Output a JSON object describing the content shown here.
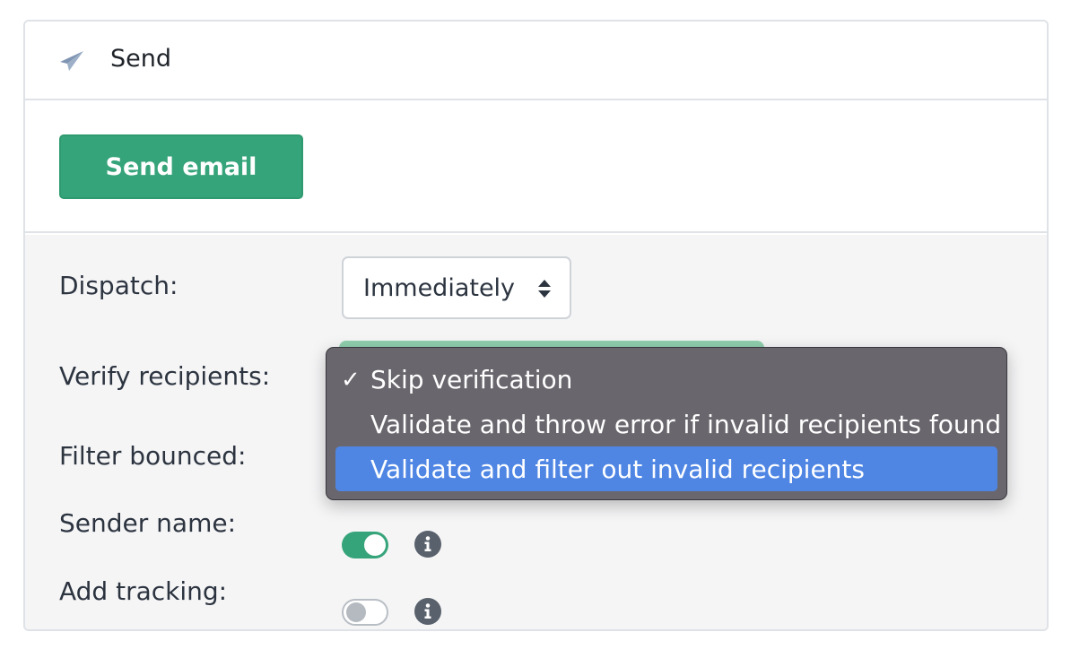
{
  "header": {
    "icon": "paper-plane-icon",
    "title": "Send"
  },
  "actions": {
    "send_email_label": "Send email"
  },
  "settings": {
    "dispatch": {
      "label": "Dispatch:",
      "value": "Immediately",
      "icon": "select-arrows-icon"
    },
    "verify_recipients": {
      "label": "Verify recipients:",
      "options": [
        {
          "label": "Skip verification",
          "checked": true
        },
        {
          "label": "Validate and throw error if invalid recipients found",
          "checked": false
        },
        {
          "label": "Validate and filter out invalid recipients",
          "checked": false,
          "highlighted": true
        }
      ],
      "check_mark": "✓"
    },
    "filter_bounced": {
      "label": "Filter bounced:"
    },
    "sender_name": {
      "label": "Sender name:",
      "toggle_on": true,
      "info_icon": "info-icon"
    },
    "add_tracking": {
      "label": "Add tracking:",
      "toggle_on": false,
      "info_icon": "info-icon"
    }
  },
  "colors": {
    "accent": "#36a47a",
    "highlight": "#4f86e4",
    "popup_bg": "#6a666d"
  }
}
